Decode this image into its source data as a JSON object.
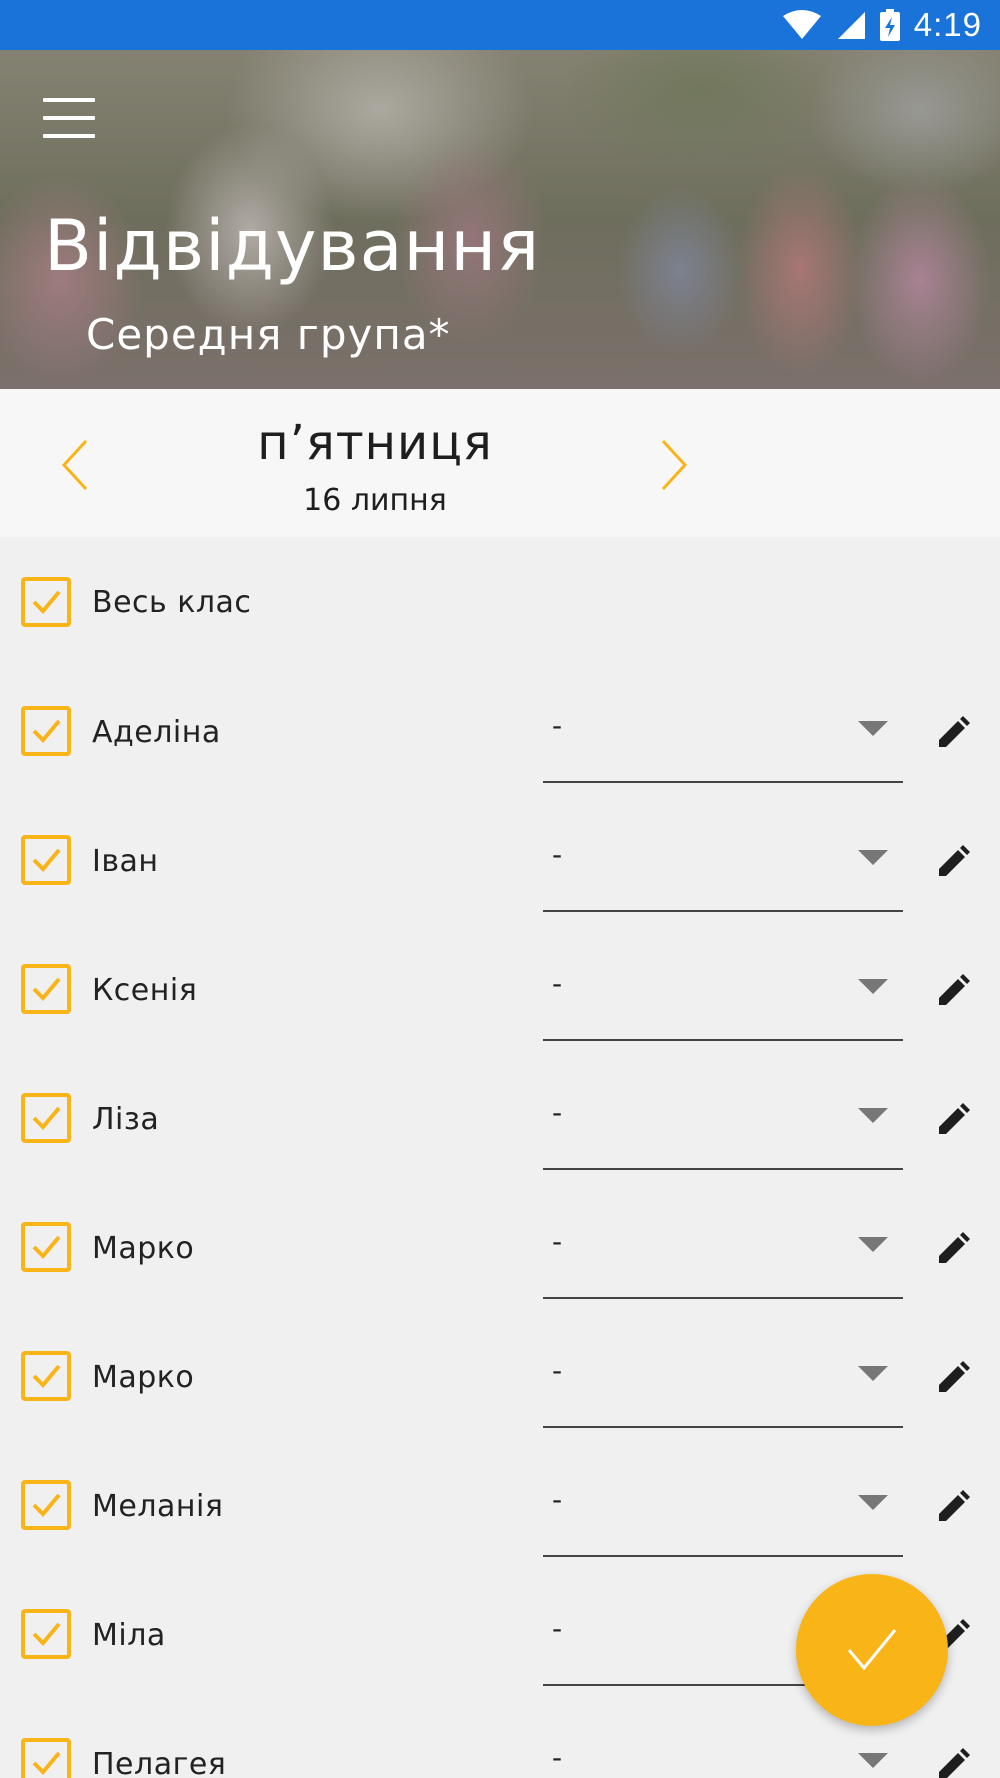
{
  "status_bar": {
    "time": "4:19"
  },
  "header": {
    "title": "Відвідування",
    "subtitle": "Середня група*"
  },
  "date_nav": {
    "day_name": "п’ятниця",
    "date": "16 липня"
  },
  "select_all": {
    "label": "Весь клас",
    "checked": true
  },
  "students": [
    {
      "name": "Аделіна",
      "status": "-",
      "checked": true
    },
    {
      "name": "Іван",
      "status": "-",
      "checked": true
    },
    {
      "name": "Ксенія",
      "status": "-",
      "checked": true
    },
    {
      "name": "Ліза",
      "status": "-",
      "checked": true
    },
    {
      "name": "Марко",
      "status": "-",
      "checked": true
    },
    {
      "name": "Марко",
      "status": "-",
      "checked": true
    },
    {
      "name": "Меланія",
      "status": "-",
      "checked": true
    },
    {
      "name": "Міла",
      "status": "-",
      "checked": true
    },
    {
      "name": "Пелагея",
      "status": "-",
      "checked": true
    }
  ],
  "colors": {
    "accent": "#f9b418",
    "status_bar": "#1a73d9",
    "background": "#f0f0f0"
  },
  "icons": {
    "menu": "menu-icon",
    "prev": "chevron-left-icon",
    "next": "chevron-right-icon",
    "edit": "pencil-icon",
    "confirm": "check-icon"
  }
}
